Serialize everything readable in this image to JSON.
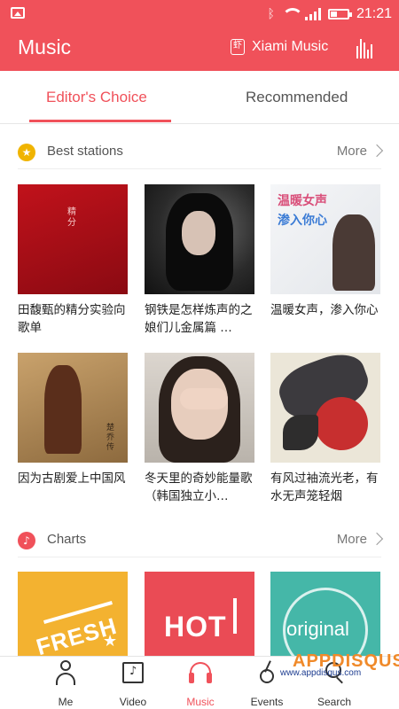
{
  "status_bar": {
    "time": "21:21"
  },
  "app_bar": {
    "title": "Music",
    "provider_label": "Xiami Music",
    "provider_icon_text": "虾"
  },
  "tabs": [
    {
      "label": "Editor's Choice",
      "active": true
    },
    {
      "label": "Recommended",
      "active": false
    }
  ],
  "sections": {
    "best_stations": {
      "title": "Best stations",
      "more_label": "More",
      "items": [
        {
          "title": "田馥甄的精分实验向歌单",
          "cover_text": "精分"
        },
        {
          "title": "钢铁是怎样炼声的之娘们儿金属篇 …"
        },
        {
          "title": "温暖女声，渗入你心",
          "cover_text_1": "温暖女声",
          "cover_text_2": "渗入你心"
        },
        {
          "title": "因为古剧爱上中国风",
          "cover_text": "楚乔传"
        },
        {
          "title": "冬天里的奇妙能量歌（韩国独立小…"
        },
        {
          "title": "有风过袖流光老，有水无声笼轻烟"
        }
      ]
    },
    "charts": {
      "title": "Charts",
      "more_label": "More",
      "items": [
        {
          "cover_text": "FRESH"
        },
        {
          "cover_text": "HOT"
        },
        {
          "cover_text": "original"
        }
      ]
    }
  },
  "bottom_nav": [
    {
      "label": "Me",
      "icon": "person-icon"
    },
    {
      "label": "Video",
      "icon": "video-icon"
    },
    {
      "label": "Music",
      "icon": "headphones-icon",
      "active": true
    },
    {
      "label": "Events",
      "icon": "guitar-icon"
    },
    {
      "label": "Search",
      "icon": "search-icon"
    }
  ],
  "watermark": {
    "logo_text": "APPDISQUS",
    "url_text": "www.appdisqus.com"
  },
  "colors": {
    "accent": "#f0515a",
    "star_badge": "#f0b400",
    "chart_badge": "#f0515a"
  }
}
